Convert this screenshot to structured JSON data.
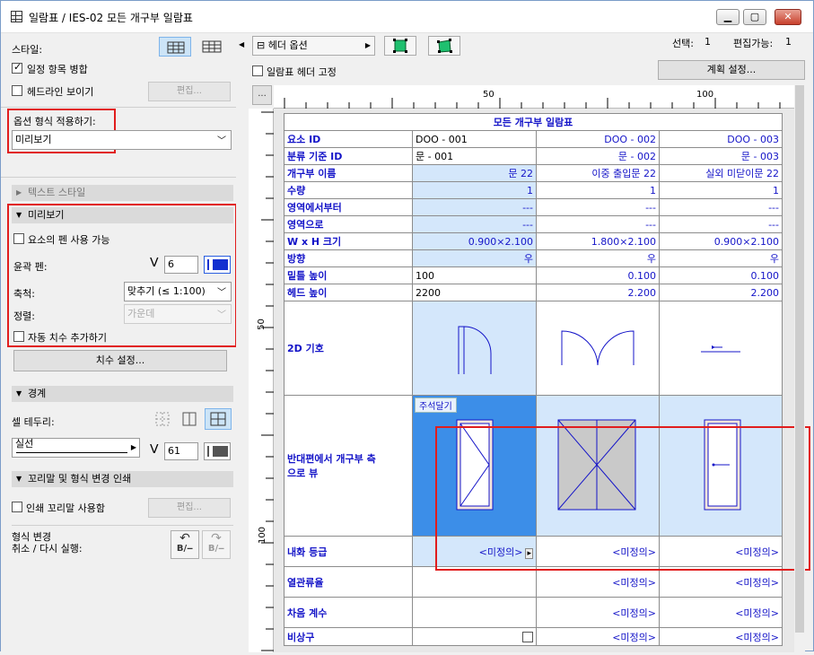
{
  "window": {
    "title": "일람표 / IES-02 모든 개구부 일람표"
  },
  "left": {
    "style_label": "스타일:",
    "merge_label": "일정 항목 병합",
    "headline_label": "헤드라인 보이기",
    "edit_label": "편집...",
    "format_label": "옵션 형식 적용하기:",
    "format_value": "미리보기",
    "text_style": "텍스트 스타일",
    "preview": "미리보기",
    "pen_label": "요소의 펜 사용 가능",
    "outline_pen": "윤곽 펜:",
    "pen_value": "6",
    "scale_label": "축척:",
    "scale_value": "맞추기 (≤ 1:100)",
    "align_label": "정렬:",
    "align_value": "가운데",
    "auto_dim": "자동 치수 추가하기",
    "dim_settings": "치수 설정...",
    "border": "경계",
    "cell_border": "셀 테두리:",
    "line_type": "실선",
    "border_pen": "61",
    "footer": "꼬리말 및 형식 변경 인쇄",
    "footer_use": "인쇄 꼬리말 사용함",
    "footer_edit": "편집...",
    "undo_label": "형식 변경\n취소 / 다시 실행:"
  },
  "toolbar": {
    "header_options": "헤더 옵션",
    "selection_label": "선택:",
    "selection_count": "1",
    "editable_label": "편집가능:",
    "editable_count": "1",
    "fix_header": "일람표 헤더 고정",
    "plan_settings": "계획 설정...",
    "ellipsis": "..."
  },
  "ruler": {
    "h": [
      "50",
      "100"
    ],
    "v": [
      "50",
      "100"
    ]
  },
  "schedule": {
    "title": "모든 개구부 일람표",
    "rows": [
      {
        "label": "요소 ID",
        "v": [
          "DOO - 001",
          "DOO - 002",
          "DOO - 003"
        ]
      },
      {
        "label": "분류 기준 ID",
        "v": [
          "문 - 001",
          "문 - 002",
          "문 - 003"
        ]
      },
      {
        "label": "개구부 이름",
        "v": [
          "문 22",
          "이중 출입문 22",
          "실외 미닫이문 22"
        ]
      },
      {
        "label": "수량",
        "v": [
          "1",
          "1",
          "1"
        ]
      },
      {
        "label": "영역에서부터",
        "v": [
          "---",
          "---",
          "---"
        ]
      },
      {
        "label": "영역으로",
        "v": [
          "---",
          "---",
          "---"
        ]
      },
      {
        "label": "W x H 크기",
        "v": [
          "0.900×2.100",
          "1.800×2.100",
          "0.900×2.100"
        ]
      },
      {
        "label": "방향",
        "v": [
          "우",
          "우",
          "우"
        ]
      },
      {
        "label": "밑틀 높이",
        "v": [
          "100",
          "0.100",
          "0.100"
        ]
      },
      {
        "label": "헤드 높이",
        "v": [
          "2200",
          "2.200",
          "2.200"
        ]
      }
    ],
    "symbol_label": "2D 기호",
    "view_label": "반대편에서 개구부 측\n으로 뷰",
    "annotate": "주석달기",
    "fire": {
      "label": "내화 등급",
      "v": [
        "<미정의>",
        "<미정의>",
        "<미정의>"
      ]
    },
    "thermal": {
      "label": "열관류율",
      "v": [
        "",
        "<미정의>",
        "<미정의>"
      ]
    },
    "sound": {
      "label": "차음 계수",
      "v": [
        "",
        "<미정의>",
        "<미정의>"
      ]
    },
    "emergency": {
      "label": "비상구",
      "v": [
        "",
        "<미정의>",
        "<미정의>"
      ]
    }
  }
}
